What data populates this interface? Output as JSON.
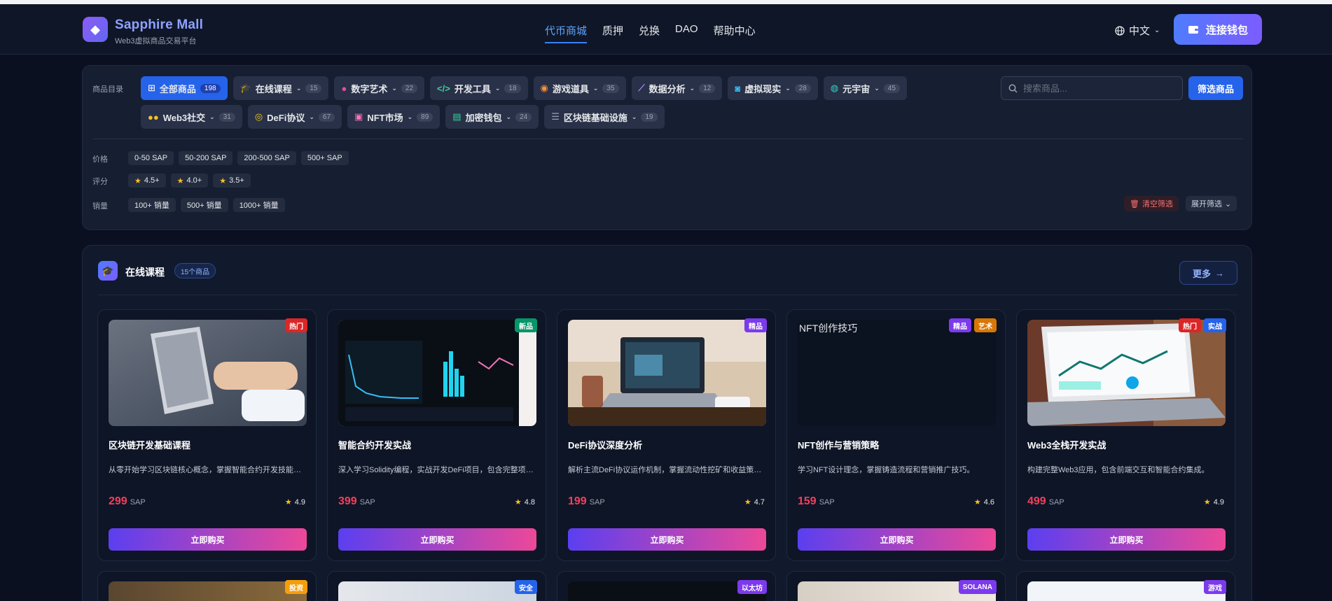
{
  "header": {
    "brand_title": "Sapphire Mall",
    "brand_subtitle": "Web3虚拟商品交易平台",
    "nav": [
      "代币商城",
      "质押",
      "兑换",
      "DAO",
      "帮助中心"
    ],
    "nav_active": "代币商城",
    "language": "中文",
    "connect_label": "连接钱包"
  },
  "filters": {
    "catalog_label": "商品目录",
    "categories_row1": [
      {
        "label": "全部商品",
        "count": "198",
        "icon": "grid-icon"
      },
      {
        "label": "在线课程",
        "count": "15",
        "icon": "graduation-cap-icon"
      },
      {
        "label": "数字艺术",
        "count": "22",
        "icon": "palette-icon"
      },
      {
        "label": "开发工具",
        "count": "18",
        "icon": "code-icon"
      },
      {
        "label": "游戏道具",
        "count": "35",
        "icon": "gamepad-icon"
      },
      {
        "label": "数据分析",
        "count": "12",
        "icon": "chart-line-icon"
      },
      {
        "label": "虚拟现实",
        "count": "28",
        "icon": "vr-headset-icon"
      },
      {
        "label": "元宇宙",
        "count": "45",
        "icon": "globe-icon"
      }
    ],
    "categories_row2": [
      {
        "label": "Web3社交",
        "count": "31",
        "icon": "users-icon"
      },
      {
        "label": "DeFi协议",
        "count": "67",
        "icon": "coins-icon"
      },
      {
        "label": "NFT市场",
        "count": "89",
        "icon": "image-icon"
      },
      {
        "label": "加密钱包",
        "count": "24",
        "icon": "wallet-icon"
      },
      {
        "label": "区块链基础设施",
        "count": "19",
        "icon": "server-icon"
      }
    ],
    "search_placeholder": "搜索商品...",
    "filter_button": "筛选商品",
    "price_label": "价格",
    "price_options": [
      "0-50 SAP",
      "50-200 SAP",
      "200-500 SAP",
      "500+ SAP"
    ],
    "rating_label": "评分",
    "rating_options": [
      "4.5+",
      "4.0+",
      "3.5+"
    ],
    "sales_label": "销量",
    "sales_options": [
      "100+ 销量",
      "500+ 销量",
      "1000+ 销量"
    ],
    "clear_label": "清空筛选",
    "expand_label": "展开筛选"
  },
  "section": {
    "title": "在线课程",
    "badge": "15个商品",
    "more_label": "更多"
  },
  "products": [
    {
      "title": "区块链开发基础课程",
      "desc": "从零开始学习区块链核心概念，掌握智能合约开发技能，...",
      "price": "299",
      "unit": "SAP",
      "rating": "4.9",
      "badges": [
        {
          "text": "热门",
          "color": "#dc2626"
        }
      ],
      "buy": "立即购买"
    },
    {
      "title": "智能合约开发实战",
      "desc": "深入学习Solidity编程，实战开发DeFi项目，包含完整项目...",
      "price": "399",
      "unit": "SAP",
      "rating": "4.8",
      "badges": [
        {
          "text": "新品",
          "color": "#059669"
        }
      ],
      "buy": "立即购买"
    },
    {
      "title": "DeFi协议深度分析",
      "desc": "解析主流DeFi协议运作机制，掌握流动性挖矿和收益策略。",
      "price": "199",
      "unit": "SAP",
      "rating": "4.7",
      "badges": [
        {
          "text": "精品",
          "color": "#7c3aed"
        }
      ],
      "buy": "立即购买"
    },
    {
      "title": "NFT创作与营销策略",
      "desc": "学习NFT设计理念，掌握铸造流程和营销推广技巧。",
      "price": "159",
      "unit": "SAP",
      "rating": "4.6",
      "badges": [
        {
          "text": "精品",
          "color": "#7c3aed"
        },
        {
          "text": "艺术",
          "color": "#d97706"
        }
      ],
      "buy": "立即购买",
      "alt": "NFT创作技巧"
    },
    {
      "title": "Web3全栈开发实战",
      "desc": "构建完整Web3应用，包含前端交互和智能合约集成。",
      "price": "499",
      "unit": "SAP",
      "rating": "4.9",
      "badges": [
        {
          "text": "热门",
          "color": "#dc2626"
        },
        {
          "text": "实战",
          "color": "#2563eb"
        }
      ],
      "buy": "立即购买"
    }
  ],
  "products_row2": [
    {
      "badge": "投资",
      "color": "#f59e0b"
    },
    {
      "badge": "安全",
      "color": "#2563eb"
    },
    {
      "badge": "以太坊",
      "color": "#7c3aed"
    },
    {
      "badge": "SOLANA",
      "color": "#7c3aed"
    },
    {
      "badge": "游戏",
      "color": "#7c3aed"
    }
  ],
  "colors": {
    "background": "#0b1020",
    "accent": "#2563eb",
    "price": "#f43f5e",
    "buy_gradient_start": "#5b3ff0",
    "buy_gradient_end": "#ec4899"
  }
}
